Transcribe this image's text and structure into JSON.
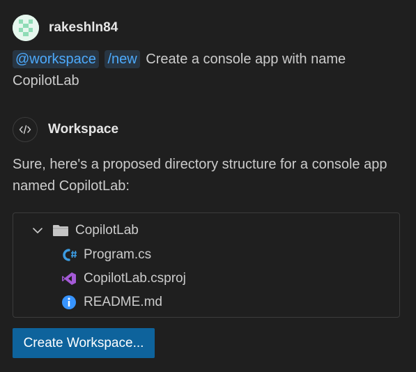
{
  "user": {
    "name": "rakeshln84",
    "avatar_icon": "identicon-avatar"
  },
  "prompt": {
    "agent_chip": "@workspace",
    "command_chip": "/new",
    "text": "Create a console app with name CopilotLab"
  },
  "agent": {
    "icon": "code-icon",
    "name": "Workspace"
  },
  "response": {
    "text": "Sure, here's a proposed directory structure for a console app named CopilotLab:"
  },
  "file_tree": {
    "folder": {
      "name": "CopilotLab",
      "expanded": true,
      "icon": "folder-icon"
    },
    "files": [
      {
        "name": "Program.cs",
        "icon": "csharp-icon"
      },
      {
        "name": "CopilotLab.csproj",
        "icon": "visual-studio-icon"
      },
      {
        "name": "README.md",
        "icon": "info-icon"
      }
    ]
  },
  "actions": {
    "create_label": "Create Workspace..."
  },
  "colors": {
    "background": "#1f1f1f",
    "chip_text": "#4daafc",
    "chip_background": "#283542",
    "button": "#0e639c",
    "csharp": "#3c9be0",
    "visual_studio": "#a45ad6",
    "info": "#3794ff"
  }
}
